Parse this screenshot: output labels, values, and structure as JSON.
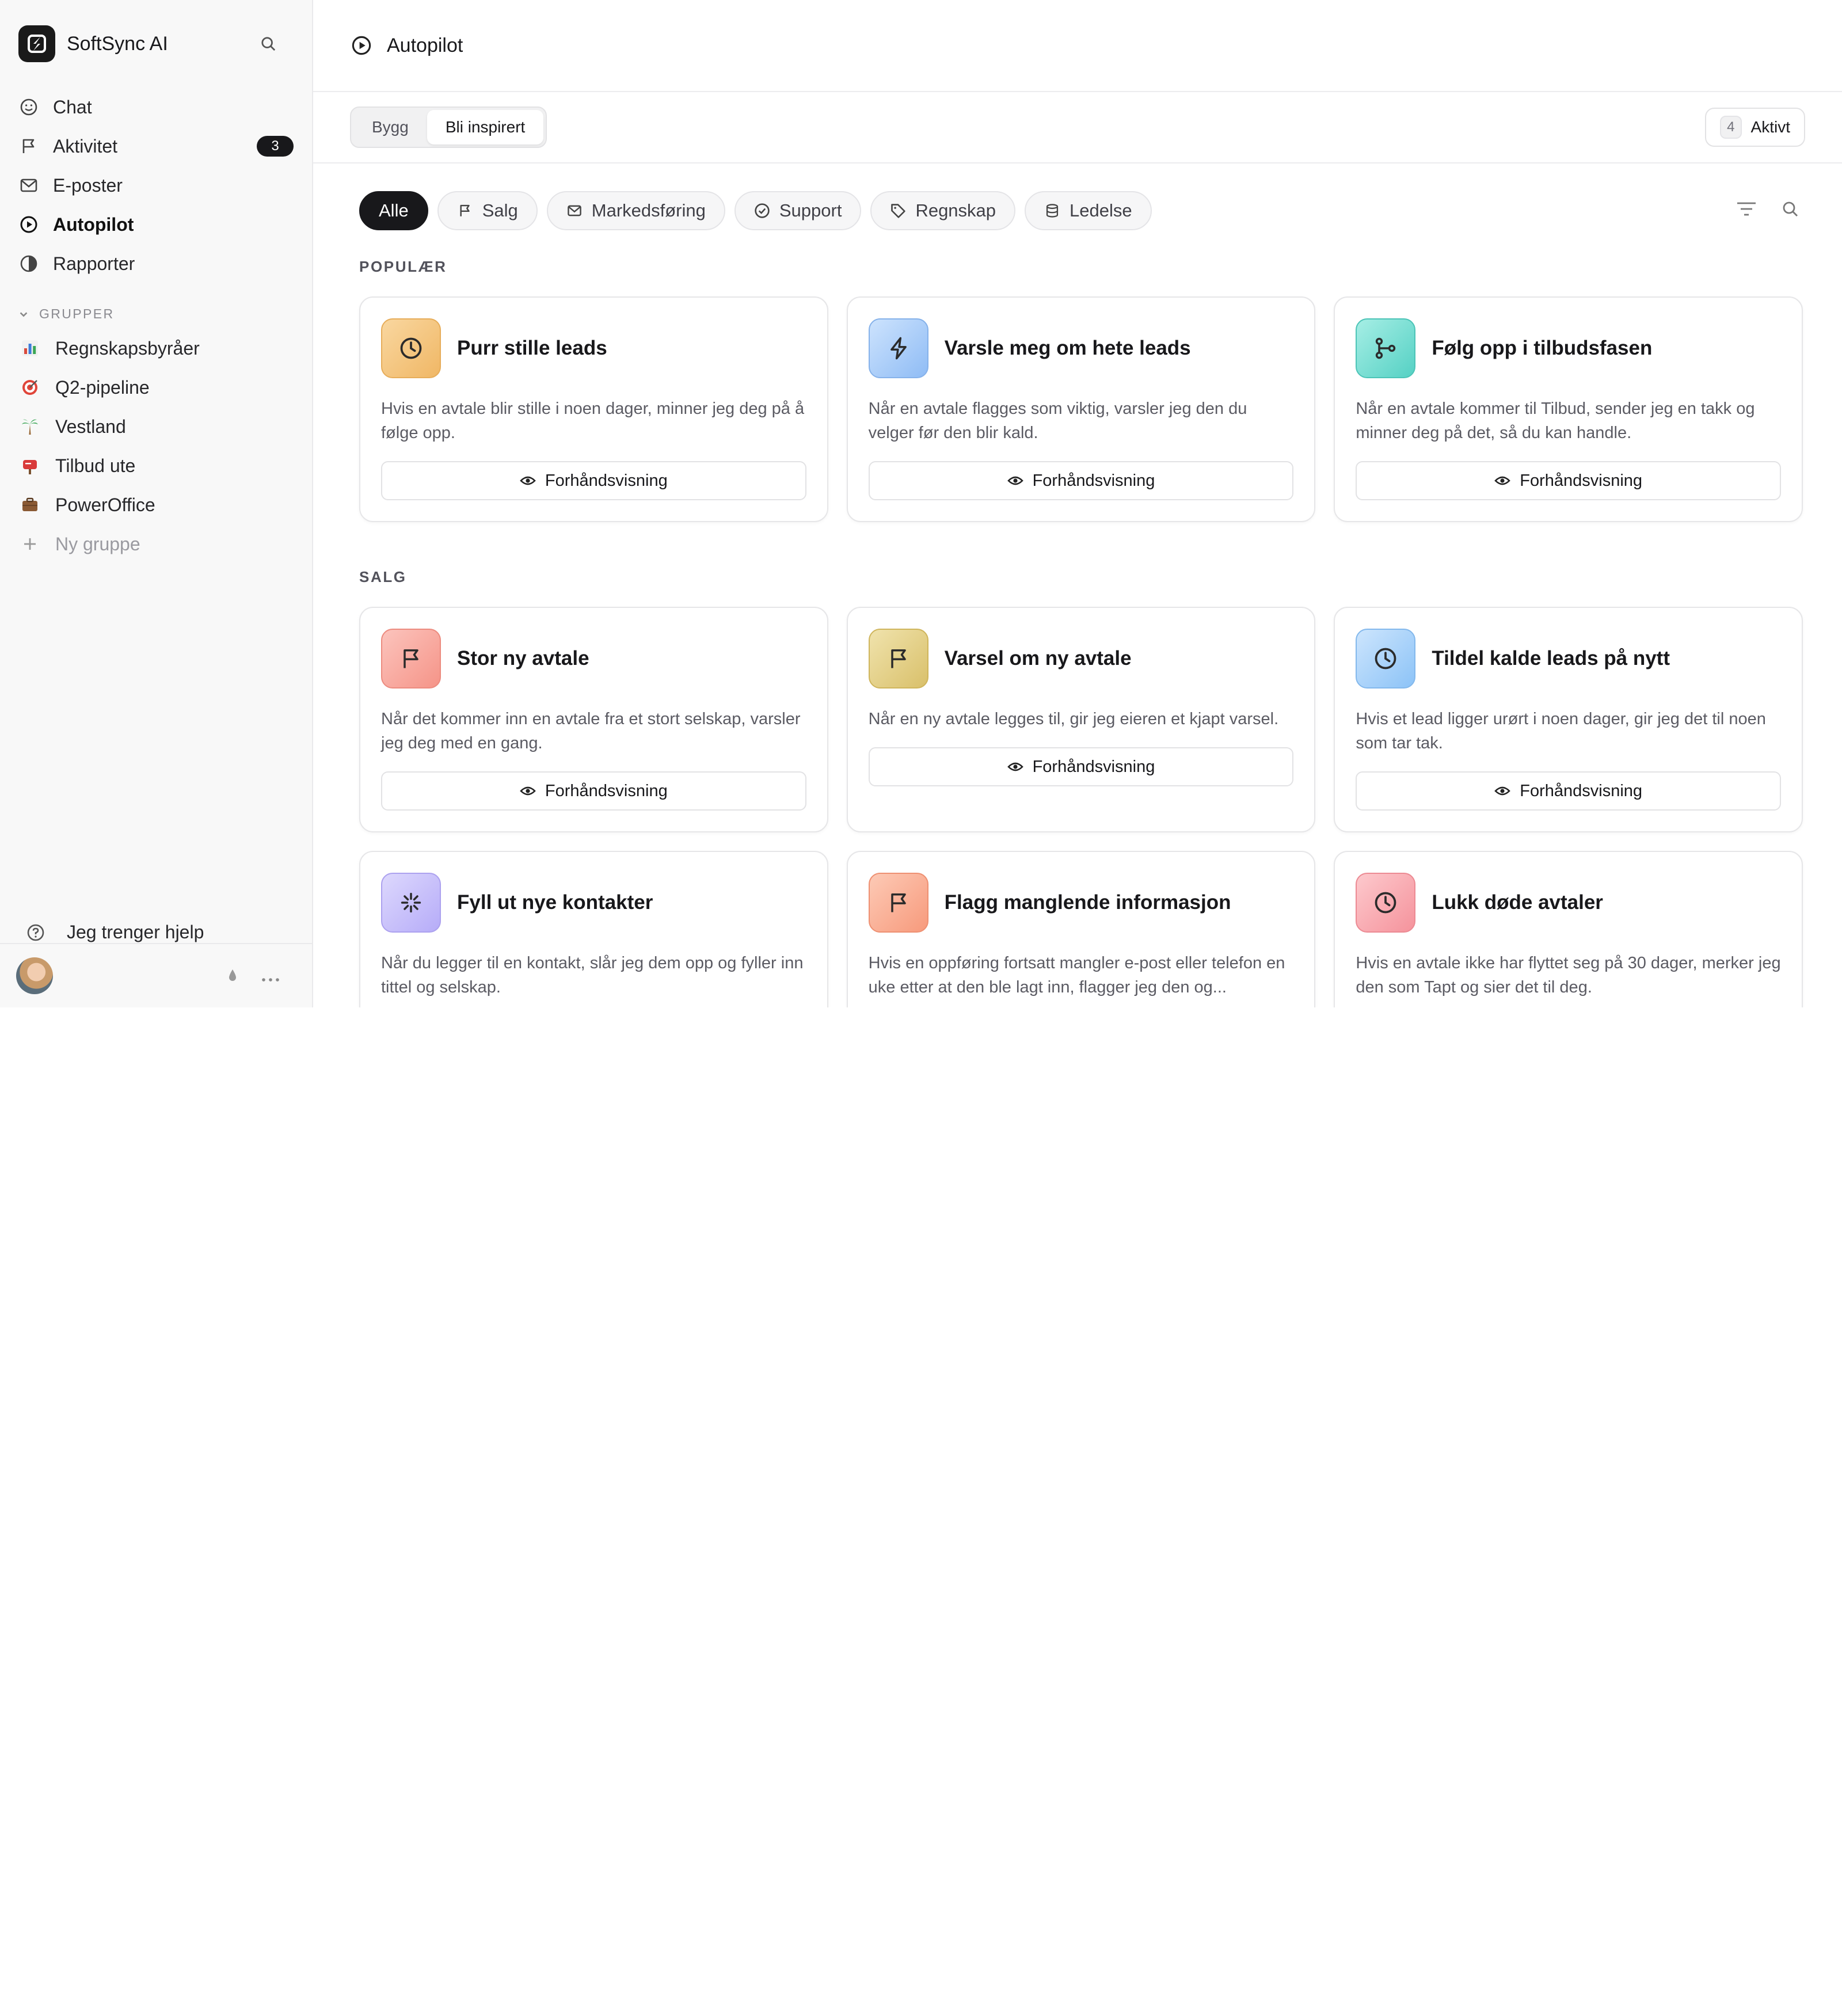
{
  "app": {
    "name": "SoftSync AI"
  },
  "nav": [
    {
      "label": "Chat",
      "icon": "smile-icon"
    },
    {
      "label": "Aktivitet",
      "icon": "flag-icon",
      "badge": "3"
    },
    {
      "label": "E-poster",
      "icon": "mail-icon"
    },
    {
      "label": "Autopilot",
      "icon": "play-circle-icon",
      "active": true
    },
    {
      "label": "Rapporter",
      "icon": "pie-chart-icon"
    }
  ],
  "groups": {
    "header": "GRUPPER",
    "items": [
      {
        "label": "Regnskapsbyråer",
        "icon": "bar-chart-emoji"
      },
      {
        "label": "Q2-pipeline",
        "icon": "target-emoji"
      },
      {
        "label": "Vestland",
        "icon": "palm-tree-emoji"
      },
      {
        "label": "Tilbud ute",
        "icon": "mailbox-emoji"
      },
      {
        "label": "PowerOffice",
        "icon": "briefcase-emoji"
      }
    ],
    "new_group": "Ny gruppe"
  },
  "help": "Jeg trenger hjelp",
  "page": {
    "title": "Autopilot"
  },
  "tabs": [
    {
      "label": "Bygg"
    },
    {
      "label": "Bli inspirert",
      "active": true
    }
  ],
  "active_count": {
    "count": "4",
    "label": "Aktivt"
  },
  "filters": [
    {
      "label": "Alle",
      "active": true
    },
    {
      "label": "Salg",
      "icon": "flag-icon"
    },
    {
      "label": "Markedsføring",
      "icon": "mail-icon"
    },
    {
      "label": "Support",
      "icon": "check-circle-icon"
    },
    {
      "label": "Regnskap",
      "icon": "tag-icon"
    },
    {
      "label": "Ledelse",
      "icon": "database-icon"
    }
  ],
  "preview_label": "Forhåndsvisning",
  "sections": [
    {
      "label": "POPULÆR",
      "cards": [
        {
          "title": "Purr stille leads",
          "desc": "Hvis en avtale blir stille i noen dager, minner jeg deg på å følge opp.",
          "icon": "clock-icon",
          "color": "#f5c27a"
        },
        {
          "title": "Varsle meg om hete leads",
          "desc": "Når en avtale flagges som viktig, varsler jeg den du velger før den blir kald.",
          "icon": "bolt-icon",
          "color": "#a9cdfa"
        },
        {
          "title": "Følg opp i tilbudsfasen",
          "desc": "Når en avtale kommer til Tilbud, sender jeg en takk og minner deg på det, så du kan handle.",
          "icon": "git-branch-icon",
          "color": "#7fe0d6"
        }
      ]
    },
    {
      "label": "SALG",
      "cards": [
        {
          "title": "Stor ny avtale",
          "desc": "Når det kommer inn en avtale fra et stort selskap, varsler jeg deg med en gang.",
          "icon": "flag-icon",
          "color": "#f9a9a0"
        },
        {
          "title": "Varsel om ny avtale",
          "desc": "Når en ny avtale legges til, gir jeg eieren et kjapt varsel.",
          "icon": "flag-icon",
          "color": "#e6d38a"
        },
        {
          "title": "Tildel kalde leads på nytt",
          "desc": "Hvis et lead ligger urørt i noen dager, gir jeg det til noen som tar tak.",
          "icon": "clock-icon",
          "color": "#a6d2fb"
        },
        {
          "title": "Fyll ut nye kontakter",
          "desc": "Når du legger til en kontakt, slår jeg dem opp og fyller inn tittel og selskap.",
          "icon": "sparkle-icon",
          "color": "#c9c2fb"
        },
        {
          "title": "Flagg manglende informasjon",
          "desc": "Hvis en oppføring fortsatt mangler e-post eller telefon en uke etter at den ble lagt inn, flagger jeg den og...",
          "icon": "flag-icon",
          "color": "#f9b39a"
        },
        {
          "title": "Lukk døde avtaler",
          "desc": "Hvis en avtale ikke har flyttet seg på 30 dager, merker jeg den som Tapt og sier det til deg.",
          "icon": "clock-icon",
          "color": "#f8b0b6"
        }
      ]
    }
  ]
}
